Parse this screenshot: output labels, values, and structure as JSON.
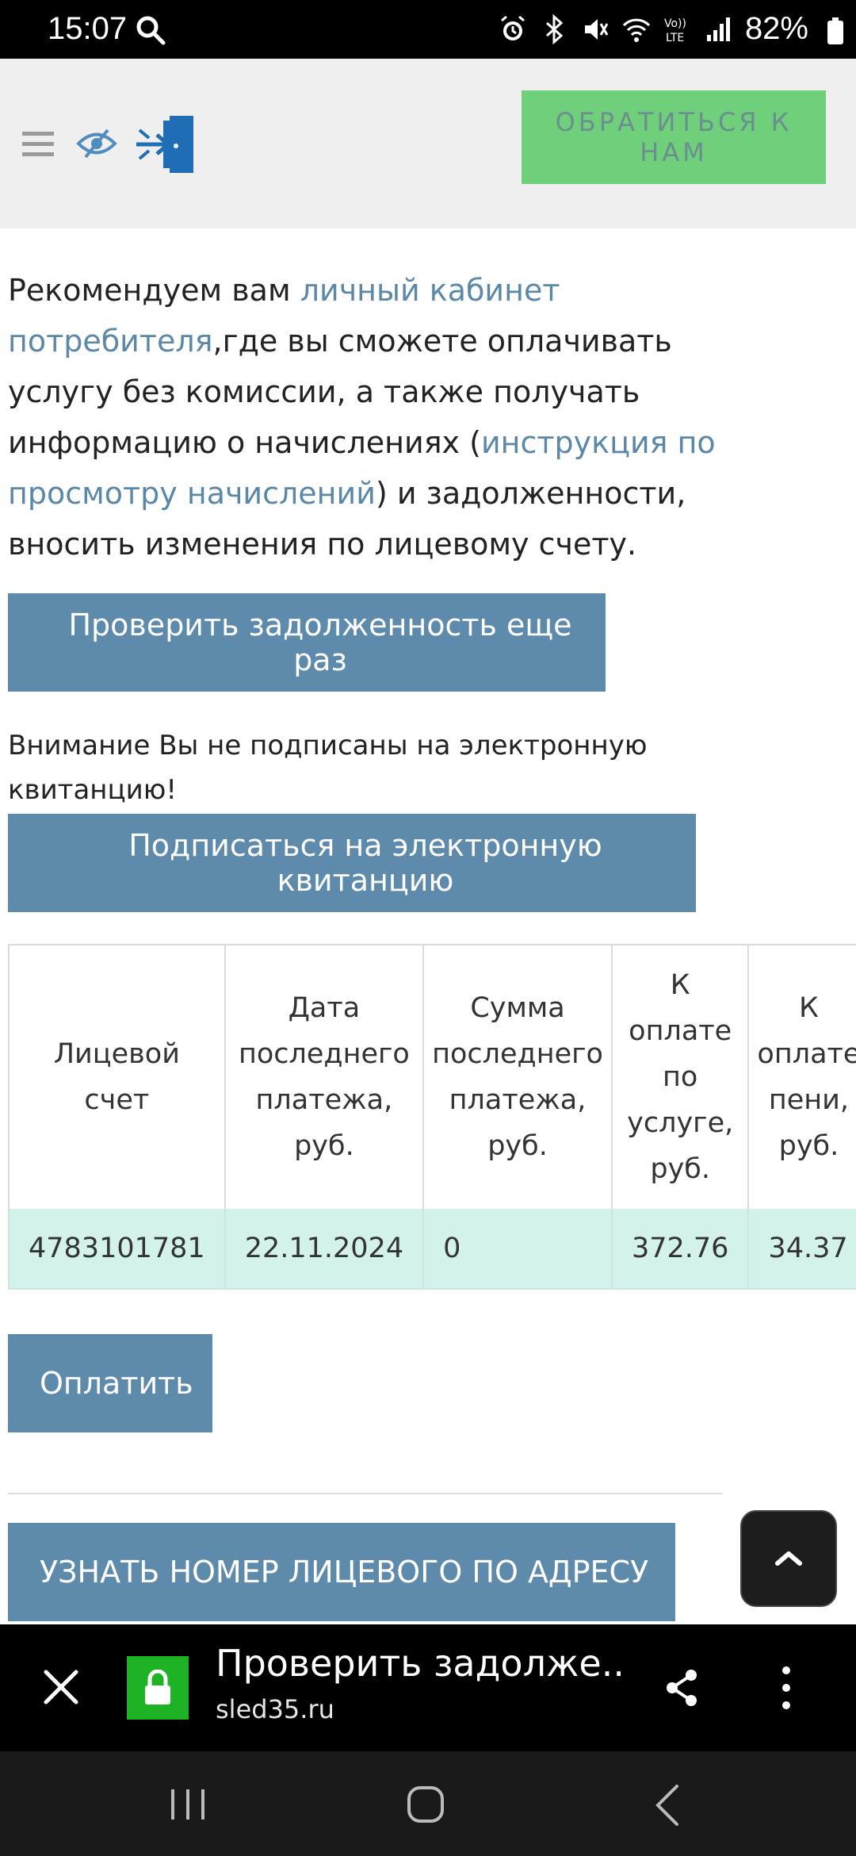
{
  "status_bar": {
    "time": "15:07",
    "battery": "82%"
  },
  "header": {
    "contact_label": "ОБРАТИТЬСЯ К НАМ"
  },
  "intro": {
    "part1": "Рекомендуем вам ",
    "link1": "личный кабинет потребителя",
    "part2": ",где вы сможете оплачивать услугу без комиссии, а также получать информацию о начислениях (",
    "link2": "инструкция по просмотру начислений",
    "part3": ") и задолженности, вносить изменения по лицевому счету."
  },
  "buttons": {
    "check_again": "Проверить задолженность еще раз",
    "subscribe": "Подписаться на электронную квитанцию",
    "pay": "Оплатить",
    "find_account": "УЗНАТЬ НОМЕР ЛИЦЕВОГО ПО АДРЕСУ"
  },
  "notice": "Внимание Вы не подписаны на электронную квитанцию!",
  "table": {
    "headers": [
      "Лицевой счет",
      "Дата последнего платежа, руб.",
      "Сумма последнего платежа, руб.",
      "К оплате по услуге, руб.",
      "К оплате пени, руб."
    ],
    "rows": [
      [
        "4783101781",
        "22.11.2024",
        "0",
        "372.76",
        "34.37"
      ]
    ]
  },
  "browser_bar": {
    "title": "Проверить задолже...",
    "domain": "sled35.ru"
  },
  "colors": {
    "accent_blue": "#5e8aab",
    "contact_green": "#6fcf7b",
    "row_bg": "#d3f2ec",
    "link": "#5b88a8"
  }
}
